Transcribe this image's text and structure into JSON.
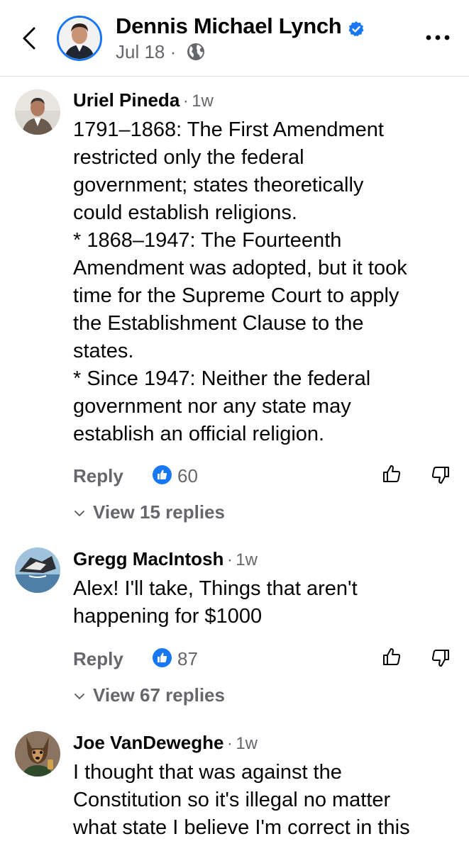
{
  "header": {
    "name": "Dennis Michael Lynch",
    "date": "Jul 18",
    "separator": "·",
    "icons": {
      "back": "chevron-left-icon",
      "verified": "verified-badge-icon",
      "audience": "globe-icon",
      "more": "more-icon"
    },
    "accent_color": "#1877f2"
  },
  "comments": [
    {
      "author": "Uriel Pineda",
      "separator": "·",
      "time": "1w",
      "lines": [
        "1791–1868: The First Amendment",
        "restricted only the federal",
        "government; states theoretically",
        "could establish religions.",
        "* 1868–1947: The Fourteenth",
        "Amendment was adopted, but it took",
        "time for the Supreme Court to apply",
        "the Establishment Clause to the",
        "states.",
        "* Since 1947: Neither the federal",
        "government nor any state may",
        "establish an official religion."
      ],
      "reply_label": "Reply",
      "like_count": "60",
      "view_replies": "View 15 replies"
    },
    {
      "author": "Gregg MacIntosh",
      "separator": "·",
      "time": "1w",
      "lines": [
        "Alex! I'll take, Things that aren't",
        "happening for $1000"
      ],
      "reply_label": "Reply",
      "like_count": "87",
      "view_replies": "View 67 replies"
    },
    {
      "author": "Joe VanDeweghe",
      "separator": "·",
      "time": "1w",
      "lines": [
        "I thought that was against the",
        "Constitution so it's illegal no matter",
        "what state I believe I'm correct in this"
      ]
    }
  ],
  "colors": {
    "secondary_text": "#65676b",
    "like_blue": "#1877f2",
    "divider": "#e4e6eb"
  }
}
